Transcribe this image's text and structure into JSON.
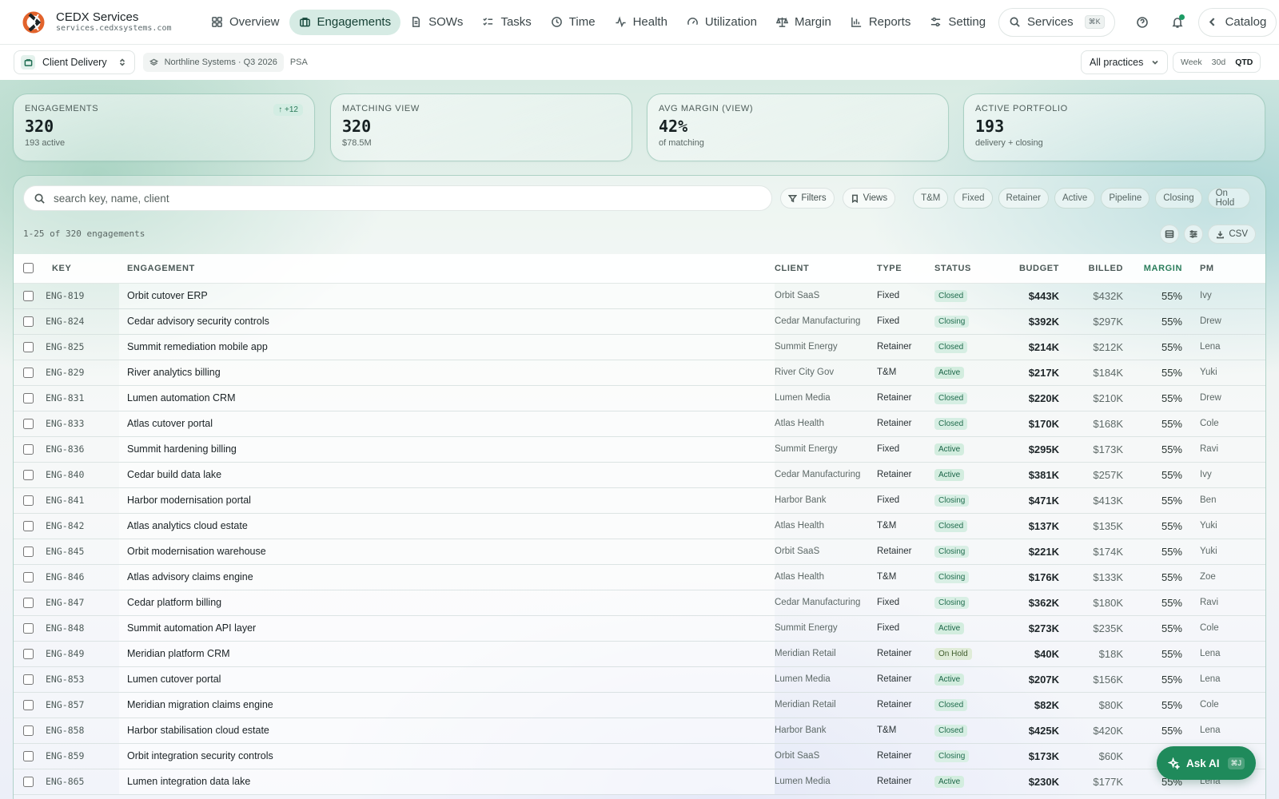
{
  "brand": {
    "name": "CEDX Services",
    "url": "services.cedxsystems.com"
  },
  "nav": {
    "items": [
      {
        "label": "Overview",
        "icon": "grid-icon"
      },
      {
        "label": "Engagements",
        "icon": "briefcase-icon",
        "active": true
      },
      {
        "label": "SOWs",
        "icon": "document-icon"
      },
      {
        "label": "Tasks",
        "icon": "checklist-icon"
      },
      {
        "label": "Time",
        "icon": "clock-icon"
      },
      {
        "label": "Health",
        "icon": "pulse-icon"
      },
      {
        "label": "Utilization",
        "icon": "gauge-icon"
      },
      {
        "label": "Margin",
        "icon": "scale-icon"
      },
      {
        "label": "Reports",
        "icon": "bar-chart-icon"
      },
      {
        "label": "Setting",
        "icon": "sliders-icon"
      }
    ],
    "search_label": "Services",
    "search_shortcut": "⌘K",
    "catalog_label": "Catalog"
  },
  "subbar": {
    "workspace": "Client Delivery",
    "context": "Northline Systems · Q3 2026",
    "tag": "PSA",
    "practice": "All practices",
    "ranges": [
      "Week",
      "30d",
      "QTD"
    ],
    "active_range": "QTD"
  },
  "kpis": [
    {
      "label": "Engagements",
      "value": "320",
      "sub": "193 active",
      "trend": "↑ +12"
    },
    {
      "label": "Matching view",
      "value": "320",
      "sub": "$78.5M"
    },
    {
      "label": "Avg margin (view)",
      "value": "42%",
      "sub": "of matching"
    },
    {
      "label": "Active portfolio",
      "value": "193",
      "sub": "delivery + closing"
    }
  ],
  "toolbar": {
    "search_placeholder": "search key, name, client",
    "filters_label": "Filters",
    "views_label": "Views",
    "chips": [
      "T&M",
      "Fixed",
      "Retainer",
      "Active",
      "Pipeline",
      "Closing",
      "On Hold"
    ],
    "count_text": "1-25 of 320 engagements",
    "csv_label": "CSV"
  },
  "table": {
    "columns": [
      "Key",
      "Engagement",
      "Client",
      "Type",
      "Status",
      "Budget",
      "Billed",
      "Margin",
      "PM"
    ],
    "rows": [
      {
        "key": "ENG-819",
        "name": "Orbit cutover ERP",
        "client": "Orbit SaaS",
        "type": "Fixed",
        "status": "Closed",
        "budget": "$443K",
        "billed": "$432K",
        "margin": "55%",
        "pm": "Ivy"
      },
      {
        "key": "ENG-824",
        "name": "Cedar advisory security controls",
        "client": "Cedar Manufacturing",
        "type": "Fixed",
        "status": "Closing",
        "budget": "$392K",
        "billed": "$297K",
        "margin": "55%",
        "pm": "Drew"
      },
      {
        "key": "ENG-825",
        "name": "Summit remediation mobile app",
        "client": "Summit Energy",
        "type": "Retainer",
        "status": "Closed",
        "budget": "$214K",
        "billed": "$212K",
        "margin": "55%",
        "pm": "Lena"
      },
      {
        "key": "ENG-829",
        "name": "River analytics billing",
        "client": "River City Gov",
        "type": "T&M",
        "status": "Active",
        "budget": "$217K",
        "billed": "$184K",
        "margin": "55%",
        "pm": "Yuki"
      },
      {
        "key": "ENG-831",
        "name": "Lumen automation CRM",
        "client": "Lumen Media",
        "type": "Retainer",
        "status": "Closed",
        "budget": "$220K",
        "billed": "$210K",
        "margin": "55%",
        "pm": "Drew"
      },
      {
        "key": "ENG-833",
        "name": "Atlas cutover portal",
        "client": "Atlas Health",
        "type": "Retainer",
        "status": "Closed",
        "budget": "$170K",
        "billed": "$168K",
        "margin": "55%",
        "pm": "Cole"
      },
      {
        "key": "ENG-836",
        "name": "Summit hardening billing",
        "client": "Summit Energy",
        "type": "Fixed",
        "status": "Active",
        "budget": "$295K",
        "billed": "$173K",
        "margin": "55%",
        "pm": "Ravi"
      },
      {
        "key": "ENG-840",
        "name": "Cedar build data lake",
        "client": "Cedar Manufacturing",
        "type": "Retainer",
        "status": "Active",
        "budget": "$381K",
        "billed": "$257K",
        "margin": "55%",
        "pm": "Ivy"
      },
      {
        "key": "ENG-841",
        "name": "Harbor modernisation portal",
        "client": "Harbor Bank",
        "type": "Fixed",
        "status": "Closing",
        "budget": "$471K",
        "billed": "$413K",
        "margin": "55%",
        "pm": "Ben"
      },
      {
        "key": "ENG-842",
        "name": "Atlas analytics cloud estate",
        "client": "Atlas Health",
        "type": "T&M",
        "status": "Closed",
        "budget": "$137K",
        "billed": "$135K",
        "margin": "55%",
        "pm": "Yuki"
      },
      {
        "key": "ENG-845",
        "name": "Orbit modernisation warehouse",
        "client": "Orbit SaaS",
        "type": "Retainer",
        "status": "Closing",
        "budget": "$221K",
        "billed": "$174K",
        "margin": "55%",
        "pm": "Yuki"
      },
      {
        "key": "ENG-846",
        "name": "Atlas advisory claims engine",
        "client": "Atlas Health",
        "type": "T&M",
        "status": "Closing",
        "budget": "$176K",
        "billed": "$133K",
        "margin": "55%",
        "pm": "Zoe"
      },
      {
        "key": "ENG-847",
        "name": "Cedar platform billing",
        "client": "Cedar Manufacturing",
        "type": "Fixed",
        "status": "Closing",
        "budget": "$362K",
        "billed": "$180K",
        "margin": "55%",
        "pm": "Ravi"
      },
      {
        "key": "ENG-848",
        "name": "Summit automation API layer",
        "client": "Summit Energy",
        "type": "Fixed",
        "status": "Active",
        "budget": "$273K",
        "billed": "$235K",
        "margin": "55%",
        "pm": "Cole"
      },
      {
        "key": "ENG-849",
        "name": "Meridian platform CRM",
        "client": "Meridian Retail",
        "type": "Retainer",
        "status": "On Hold",
        "budget": "$40K",
        "billed": "$18K",
        "margin": "55%",
        "pm": "Lena"
      },
      {
        "key": "ENG-853",
        "name": "Lumen cutover portal",
        "client": "Lumen Media",
        "type": "Retainer",
        "status": "Active",
        "budget": "$207K",
        "billed": "$156K",
        "margin": "55%",
        "pm": "Lena"
      },
      {
        "key": "ENG-857",
        "name": "Meridian migration claims engine",
        "client": "Meridian Retail",
        "type": "Retainer",
        "status": "Closed",
        "budget": "$82K",
        "billed": "$80K",
        "margin": "55%",
        "pm": "Cole"
      },
      {
        "key": "ENG-858",
        "name": "Harbor stabilisation cloud estate",
        "client": "Harbor Bank",
        "type": "T&M",
        "status": "Closed",
        "budget": "$425K",
        "billed": "$420K",
        "margin": "55%",
        "pm": "Lena"
      },
      {
        "key": "ENG-859",
        "name": "Orbit integration security controls",
        "client": "Orbit SaaS",
        "type": "Retainer",
        "status": "Closing",
        "budget": "$173K",
        "billed": "$60K",
        "margin": "55%",
        "pm": "Ravi"
      },
      {
        "key": "ENG-865",
        "name": "Lumen integration data lake",
        "client": "Lumen Media",
        "type": "Retainer",
        "status": "Active",
        "budget": "$230K",
        "billed": "$177K",
        "margin": "55%",
        "pm": "Lena"
      }
    ]
  },
  "ask_ai": {
    "label": "Ask AI",
    "shortcut": "⌘J"
  },
  "colors": {
    "accent": "#1f8a5b",
    "nav_active_bg": "#d6ebe4",
    "status_bg": "#d6eee3"
  }
}
